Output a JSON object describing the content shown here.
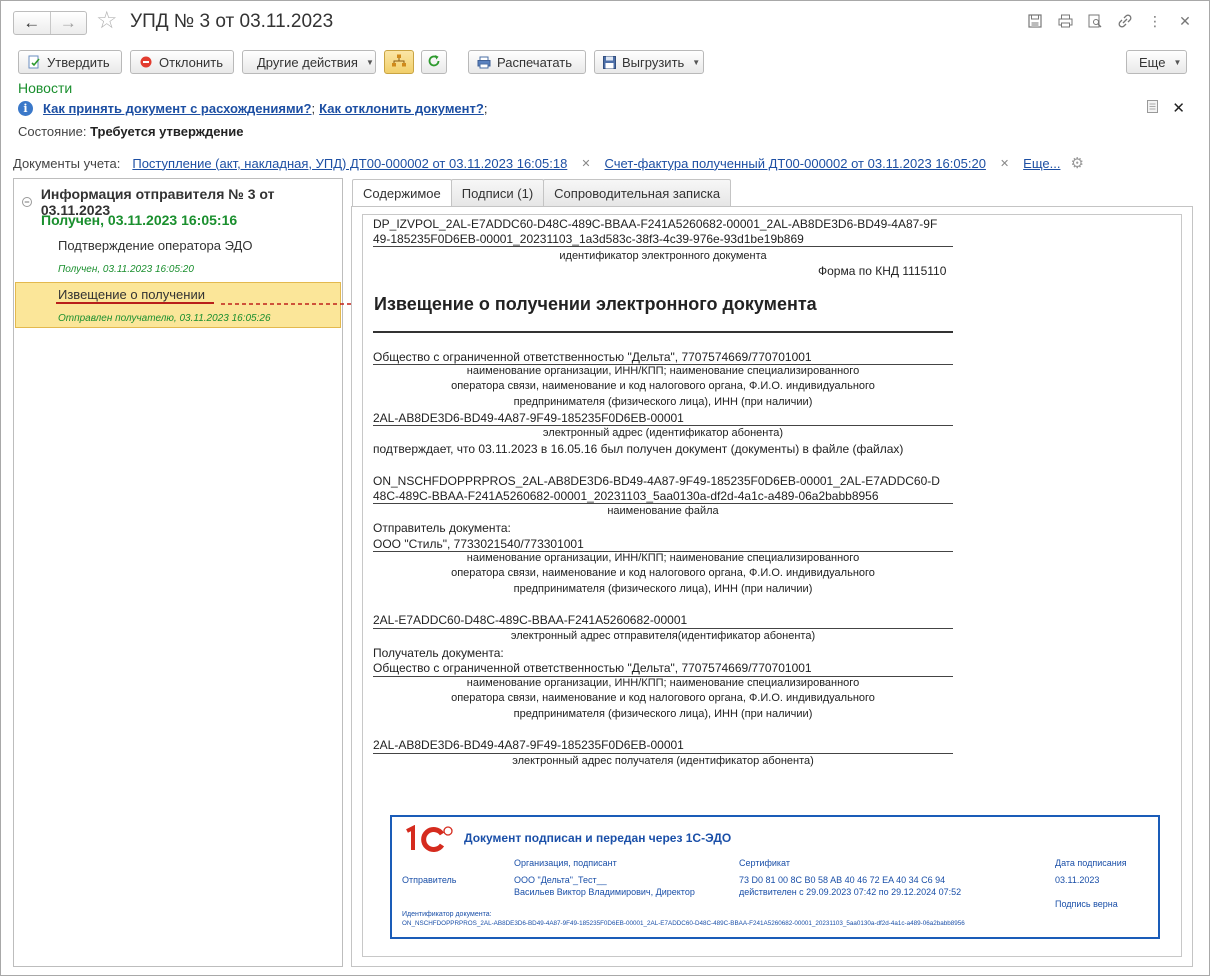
{
  "window": {
    "title": "УПД № 3 от 03.11.2023"
  },
  "toolbar": {
    "approve": "Утвердить",
    "reject": "Отклонить",
    "other": "Другие действия",
    "print": "Распечатать",
    "export": "Выгрузить",
    "more": "Еще"
  },
  "news": "Новости",
  "info": {
    "link1": "Как принять документ с расхождениями?",
    "sep": ";",
    "link2": "Как отклонить документ?",
    "end": ";"
  },
  "state": {
    "label": "Состояние:",
    "value": "Требуется утверждение"
  },
  "docs": {
    "label": "Документы учета:",
    "link1": "Поступление (акт, накладная, УПД) ДТ00-000002 от 03.11.2023 16:05:18",
    "link2": "Счет-фактура полученный ДТ00-000002 от 03.11.2023 16:05:20",
    "more": "Еще..."
  },
  "tree": {
    "root": "Информация отправителя № 3 от 03.11.2023",
    "received": "Получен, 03.11.2023 16:05:16",
    "item1": "Подтверждение оператора ЭДО",
    "item1_sub": "Получен, 03.11.2023 16:05:20",
    "item2": "Извещение о получении",
    "item2_sub": "Отправлен получателю, 03.11.2023 16:05:26"
  },
  "tabs": [
    "Содержимое",
    "Подписи (1)",
    "Сопроводительная записка"
  ],
  "doc": {
    "id1": "DP_IZVPOL_2AL-E7ADDC60-D48C-489C-BBAA-F241A5260682-00001_2AL-AB8DE3D6-BD49-4A87-9F",
    "id2": "49-185235F0D6EB-00001_20231103_1a3d583c-38f3-4c39-976e-93d1be19b869",
    "id_cap": "идентификатор электронного документа",
    "form": "Форма по КНД 1115110",
    "heading": "Извещение о получении электронного документа",
    "org1": "Общество с ограниченной ответственностью \"Дельта\", 7707574669/770701001",
    "cap_a1": "наименование организации, ИНН/КПП; наименование специализированного",
    "cap_a2": "оператора связи, наименование и код налогового органа, Ф.И.О. индивидуального",
    "cap_a3": "предпринимателя (физического лица), ИНН (при наличии)",
    "addr1": "2AL-AB8DE3D6-BD49-4A87-9F49-185235F0D6EB-00001",
    "addr_cap": "электронный адрес (идентификатор абонента)",
    "confirm": "подтверждает, что 03.11.2023 в 16.05.16 был получен документ (документы) в файле (файлах)",
    "file1": "ON_NSCHFDOPPRPROS_2AL-AB8DE3D6-BD49-4A87-9F49-185235F0D6EB-00001_2AL-E7ADDC60-D",
    "file2": "48C-489C-BBAA-F241A5260682-00001_20231103_5aa0130a-df2d-4a1c-a489-06a2babb8956",
    "file_cap": "наименование файла",
    "sender_label": "Отправитель документа:",
    "sender": "ООО \"Стиль\", 7733021540/773301001",
    "sender_addr": "2AL-E7ADDC60-D48C-489C-BBAA-F241A5260682-00001",
    "sender_addr_cap": "электронный адрес отправителя(идентификатор абонента)",
    "recv_label": "Получатель документа:",
    "recv": "Общество с ограниченной ответственностью \"Дельта\", 7707574669/770701001",
    "recv_addr": "2AL-AB8DE3D6-BD49-4A87-9F49-185235F0D6EB-00001",
    "recv_addr_cap": "электронный адрес получателя (идентификатор абонента)"
  },
  "stamp": {
    "title": "Документ подписан и передан через 1С-ЭДО",
    "col_org": "Организация, подписант",
    "col_cert": "Сертификат",
    "col_date": "Дата подписания",
    "row_label": "Отправитель",
    "org": "ООО \"Дельта\"_Тест__",
    "signer": "Васильев  Виктор Владимирович, Директор",
    "cert": "73 D0 81 00 8C B0 58 AB 40 46 72 EA 40 34 C6 94",
    "valid": "действителен с 29.09.2023 07:42 по 29.12.2024 07:52",
    "date": "03.11.2023",
    "sig_ok": "Подпись верна",
    "docid_label": "Идентификатор документа:",
    "docid": "ON_NSCHFDOPPRPROS_2AL-AB8DE3D6-BD49-4A87-9F49-185235F0D6EB-00001_2AL-E7ADDC60-D48C-489C-BBAA-F241A5260682-00001_20231103_5aa0130a-df2d-4a1c-a489-06a2babb8956"
  },
  "colors": {
    "link": "#1d4fa3",
    "green": "#1a8f2e",
    "selected": "#fbe699",
    "stamp": "#1a5cb8"
  }
}
